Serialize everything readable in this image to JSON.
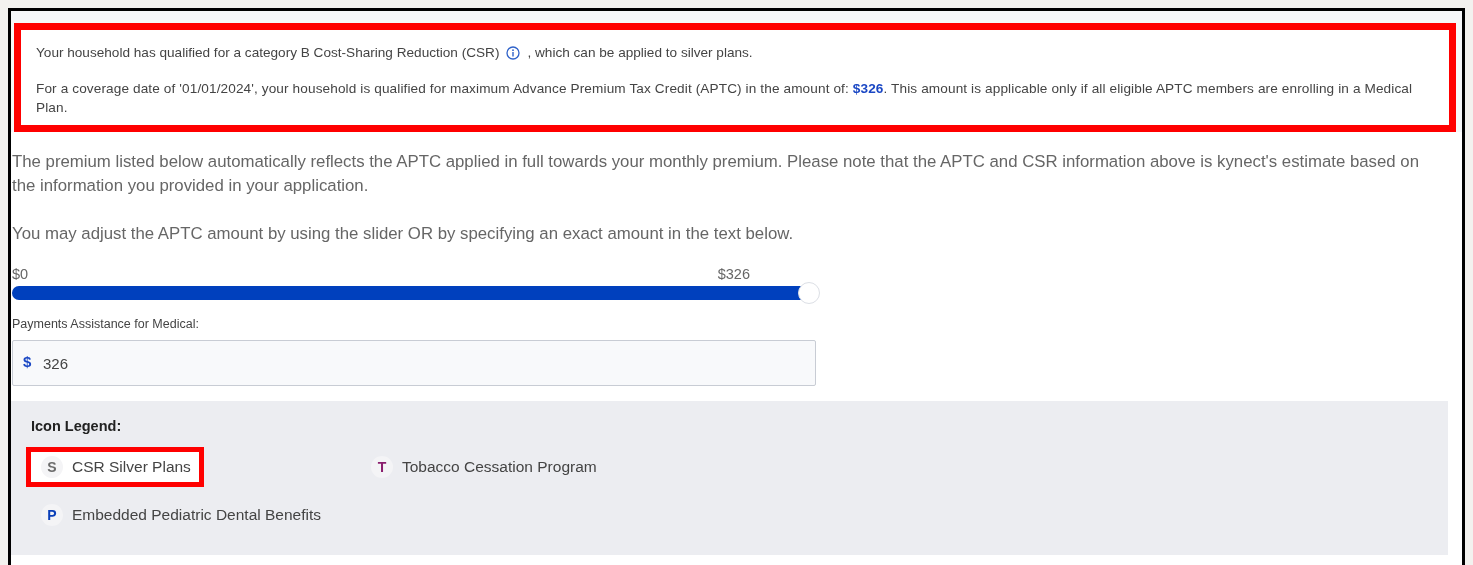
{
  "notice": {
    "highlighted": true,
    "csr_text_before": "Your household has qualified for a category B Cost-Sharing Reduction (CSR)",
    "csr_text_after": ", which can be applied to silver plans.",
    "aptc_text": "For a coverage date of '01/01/2024', your household is qualified for maximum Advance Premium Tax Credit (APTC) in the amount of: **$326**. This amount is applicable only if all eligible APTC members are enrolling in a Medical Plan."
  },
  "explanation": "The premium listed below automatically reflects the APTC applied in full towards your monthly premium. Please note that the APTC and CSR information above is kynect's estimate based on the information you provided in your application.",
  "instruction": "You may adjust the APTC amount by using the slider OR by specifying an exact amount in the text below.",
  "slider": {
    "min_label": "$0",
    "max_label": "$326",
    "level": 1.0
  },
  "amount_field": {
    "label": "Payments Assistance for Medical:",
    "prefix": "$",
    "value": "326"
  },
  "legend": {
    "title": "Icon Legend:",
    "items": [
      {
        "letter": "S",
        "label": "CSR Silver Plans",
        "color": "#6b6b6b",
        "highlighted": true
      },
      {
        "letter": "T",
        "label": "Tobacco Cessation Program",
        "color": "#8a1f6e",
        "highlighted": false
      },
      {
        "letter": "P",
        "label": "Embedded Pediatric Dental Benefits",
        "color": "#0a3fb8",
        "highlighted": false
      }
    ]
  }
}
